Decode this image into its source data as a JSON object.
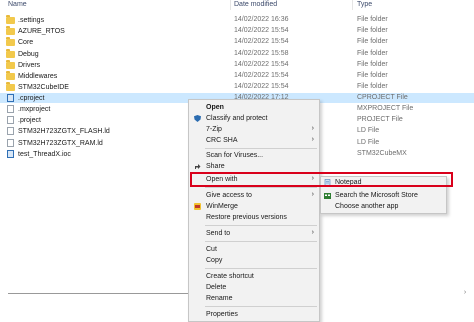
{
  "header": {
    "name": "Name",
    "date": "Date modified",
    "type": "Type"
  },
  "files": [
    {
      "name": ".settings",
      "date": "14/02/2022 16:36",
      "type": "File folder",
      "icon": "folder-icon"
    },
    {
      "name": "AZURE_RTOS",
      "date": "14/02/2022 15:54",
      "type": "File folder",
      "icon": "folder-icon"
    },
    {
      "name": "Core",
      "date": "14/02/2022 15:54",
      "type": "File folder",
      "icon": "folder-icon"
    },
    {
      "name": "Debug",
      "date": "14/02/2022 15:58",
      "type": "File folder",
      "icon": "folder-icon"
    },
    {
      "name": "Drivers",
      "date": "14/02/2022 15:54",
      "type": "File folder",
      "icon": "folder-icon"
    },
    {
      "name": "Middlewares",
      "date": "14/02/2022 15:54",
      "type": "File folder",
      "icon": "folder-icon"
    },
    {
      "name": "STM32CubeIDE",
      "date": "14/02/2022 15:54",
      "type": "File folder",
      "icon": "folder-icon"
    },
    {
      "name": ".cproject",
      "date": "14/02/2022 17:12",
      "type": "CPROJECT File",
      "icon": "file-icon",
      "selected": true
    },
    {
      "name": ".mxproject",
      "date": "",
      "type": "MXPROJECT File",
      "icon": "file-icon"
    },
    {
      "name": ".project",
      "date": "",
      "type": "PROJECT File",
      "icon": "file-icon"
    },
    {
      "name": "STM32H723ZGTX_FLASH.ld",
      "date": "",
      "type": "LD File",
      "icon": "file-icon"
    },
    {
      "name": "STM32H723ZGTX_RAM.ld",
      "date": "",
      "type": "LD File",
      "icon": "file-icon"
    },
    {
      "name": "test_ThreadX.ioc",
      "date": "",
      "type": "STM32CubeMX",
      "icon": "file-icon-blue"
    }
  ],
  "context_menu": {
    "open": "Open",
    "classify": "Classify and protect",
    "zip": "7-Zip",
    "crc": "CRC SHA",
    "scan": "Scan for Viruses...",
    "share": "Share",
    "open_with": "Open with",
    "give_access": "Give access to",
    "winmerge": "WinMerge",
    "restore": "Restore previous versions",
    "send_to": "Send to",
    "cut": "Cut",
    "copy": "Copy",
    "create_shortcut": "Create shortcut",
    "delete": "Delete",
    "rename": "Rename",
    "properties": "Properties"
  },
  "submenu": {
    "notepad": "Notepad",
    "store": "Search the Microsoft Store",
    "another": "Choose another app"
  },
  "colors": {
    "highlight": "#d9001b",
    "selection": "#cce8ff",
    "menu_bg": "#f2f2f2"
  }
}
